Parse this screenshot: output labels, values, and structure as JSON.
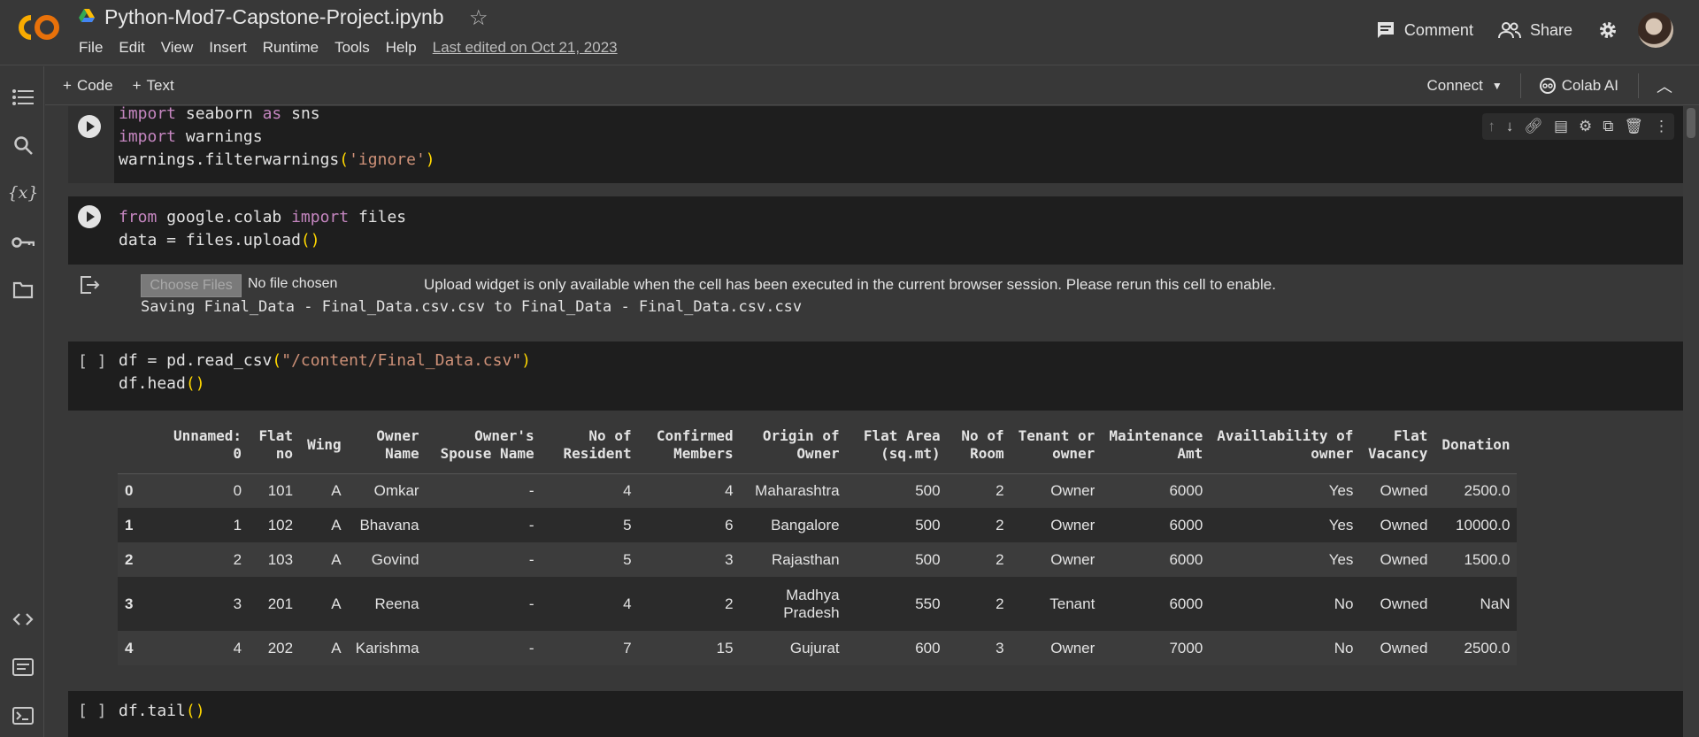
{
  "header": {
    "title": "Python-Mod7-Capstone-Project.ipynb",
    "menu": [
      "File",
      "Edit",
      "View",
      "Insert",
      "Runtime",
      "Tools",
      "Help"
    ],
    "last_edited": "Last edited on Oct 21, 2023",
    "comment_label": "Comment",
    "share_label": "Share"
  },
  "toolbar": {
    "add_code": "Code",
    "add_text": "Text",
    "connect": "Connect",
    "colab_ai": "Colab AI"
  },
  "cells": {
    "c1": {
      "lines": [
        [
          [
            "kw",
            "import"
          ],
          [
            "t",
            " seaborn "
          ],
          [
            "kw",
            "as"
          ],
          [
            "t",
            " sns"
          ]
        ],
        [
          [
            "kw",
            "import"
          ],
          [
            "t",
            " warnings"
          ]
        ],
        [
          [
            "t",
            "warnings.filterwarnings"
          ],
          [
            "p",
            "("
          ],
          [
            "s",
            "'ignore'"
          ],
          [
            "p",
            ")"
          ]
        ]
      ]
    },
    "c2": {
      "lines": [
        [
          [
            "kw",
            "from"
          ],
          [
            "t",
            " google.colab "
          ],
          [
            "kw",
            "import"
          ],
          [
            "t",
            " files"
          ]
        ],
        [
          [
            "t",
            "data = files.upload"
          ],
          [
            "p",
            "()"
          ]
        ]
      ],
      "output": {
        "choose_files": "Choose Files",
        "no_file": "No file chosen",
        "message": "Upload widget is only available when the cell has been executed in the current browser session. Please rerun this cell to enable.",
        "saving": "Saving Final_Data - Final_Data.csv.csv to Final_Data - Final_Data.csv.csv"
      }
    },
    "c3": {
      "bracket": "[ ]",
      "lines": [
        [
          [
            "t",
            "df = pd.read_csv"
          ],
          [
            "p",
            "("
          ],
          [
            "s",
            "\"/content/Final_Data.csv\""
          ],
          [
            "p",
            ")"
          ]
        ],
        [
          [
            "t",
            "df.head"
          ],
          [
            "p",
            "()"
          ]
        ]
      ]
    },
    "c4": {
      "bracket": "[ ]",
      "lines": [
        [
          [
            "t",
            "df.tail"
          ],
          [
            "p",
            "()"
          ]
        ]
      ]
    }
  },
  "table": {
    "columns": [
      "",
      "Unnamed:\n0",
      "Flat\nno",
      "Wing",
      "Owner\nName",
      "Owner's\nSpouse Name",
      "No of\nResident",
      "Confirmed\nMembers",
      "Origin of\nOwner",
      "Flat Area\n(sq.mt)",
      "No of\nRoom",
      "Tenant or\nowner",
      "Maintenance\nAmt",
      "Availlability of\nowner",
      "Flat\nVacancy",
      "Donation"
    ],
    "rows": [
      [
        "0",
        "0",
        "101",
        "A",
        "Omkar",
        "-",
        "4",
        "4",
        "Maharashtra",
        "500",
        "2",
        "Owner",
        "6000",
        "Yes",
        "Owned",
        "2500.0"
      ],
      [
        "1",
        "1",
        "102",
        "A",
        "Bhavana",
        "-",
        "5",
        "6",
        "Bangalore",
        "500",
        "2",
        "Owner",
        "6000",
        "Yes",
        "Owned",
        "10000.0"
      ],
      [
        "2",
        "2",
        "103",
        "A",
        "Govind",
        "-",
        "5",
        "3",
        "Rajasthan",
        "500",
        "2",
        "Owner",
        "6000",
        "Yes",
        "Owned",
        "1500.0"
      ],
      [
        "3",
        "3",
        "201",
        "A",
        "Reena",
        "-",
        "4",
        "2",
        "Madhya\nPradesh",
        "550",
        "2",
        "Tenant",
        "6000",
        "No",
        "Owned",
        "NaN"
      ],
      [
        "4",
        "4",
        "202",
        "A",
        "Karishma",
        "-",
        "7",
        "15",
        "Gujurat",
        "600",
        "3",
        "Owner",
        "7000",
        "No",
        "Owned",
        "2500.0"
      ]
    ]
  }
}
